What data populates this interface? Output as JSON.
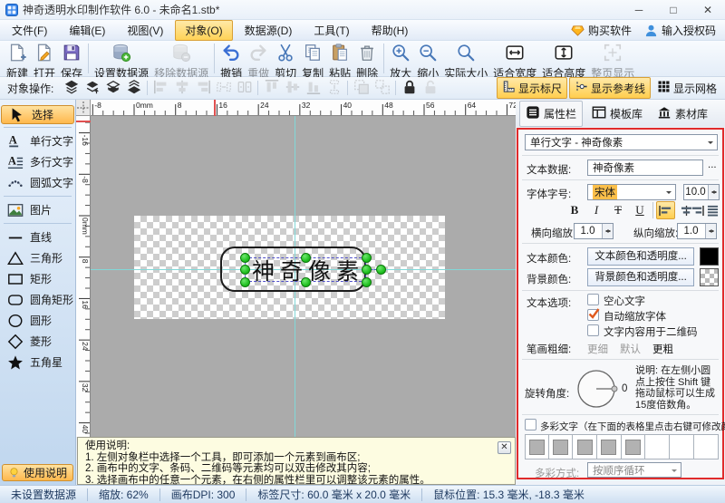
{
  "window": {
    "title": "神奇透明水印制作软件 6.0 - 未命名1.stb*",
    "minimize": "─",
    "maximize": "□",
    "close": "✕"
  },
  "menu": {
    "items": [
      {
        "name": "file",
        "label": "文件(F)"
      },
      {
        "name": "edit",
        "label": "编辑(E)"
      },
      {
        "name": "view",
        "label": "视图(V)"
      },
      {
        "name": "object",
        "label": "对象(O)",
        "cls": "active"
      },
      {
        "name": "datasource",
        "label": "数据源(D)"
      },
      {
        "name": "tools",
        "label": "工具(T)"
      },
      {
        "name": "help",
        "label": "帮助(H)"
      }
    ],
    "buy_label": "购买软件",
    "license_label": "输入授权码"
  },
  "toolbar": {
    "items": [
      {
        "name": "new",
        "label": "新建",
        "icon": "doc-new"
      },
      {
        "name": "open",
        "label": "打开",
        "icon": "doc-open"
      },
      {
        "name": "save",
        "label": "保存",
        "icon": "save"
      },
      {
        "type": "sep"
      },
      {
        "name": "set-datasource",
        "label": "设置数据源",
        "icon": "db-set"
      },
      {
        "name": "remove-datasource",
        "label": "移除数据源",
        "icon": "db-remove",
        "cls": "disabled"
      },
      {
        "type": "sep"
      },
      {
        "name": "undo",
        "label": "撤销",
        "icon": "undo"
      },
      {
        "name": "redo",
        "label": "重做",
        "icon": "redo",
        "cls": "disabled"
      },
      {
        "name": "cut",
        "label": "剪切",
        "icon": "cut"
      },
      {
        "name": "copy",
        "label": "复制",
        "icon": "copy"
      },
      {
        "name": "paste",
        "label": "粘贴",
        "icon": "paste"
      },
      {
        "name": "delete",
        "label": "删除",
        "icon": "delete"
      },
      {
        "type": "sep"
      },
      {
        "name": "zoom-in",
        "label": "放大",
        "icon": "zoom-in"
      },
      {
        "name": "zoom-out",
        "label": "缩小",
        "icon": "zoom-out"
      },
      {
        "name": "actual-size",
        "label": "实际大小",
        "icon": "zoom-actual"
      },
      {
        "name": "fit-width",
        "label": "适合宽度",
        "icon": "fit-width"
      },
      {
        "name": "fit-height",
        "label": "适合高度",
        "icon": "fit-height"
      },
      {
        "name": "fit-page",
        "label": "整页显示",
        "icon": "fit-page",
        "cls": "disabled"
      }
    ]
  },
  "objectbar": {
    "label": "对象操作:",
    "items": [
      {
        "name": "layer-top",
        "icon": "layer-top"
      },
      {
        "name": "layer-up",
        "icon": "layer-up"
      },
      {
        "name": "layer-down",
        "icon": "layer-down"
      },
      {
        "name": "layer-bottom",
        "icon": "layer-bottom"
      },
      {
        "type": "sep"
      },
      {
        "name": "align-left",
        "icon": "oalign-left",
        "cls": "disabled"
      },
      {
        "name": "align-center",
        "icon": "oalign-center",
        "cls": "disabled"
      },
      {
        "name": "align-right",
        "icon": "oalign-right",
        "cls": "disabled"
      },
      {
        "name": "space-horizontal",
        "icon": "space-h",
        "cls": "disabled"
      },
      {
        "name": "same-width",
        "icon": "same-w",
        "cls": "disabled"
      },
      {
        "type": "sep"
      },
      {
        "name": "align-top",
        "icon": "oalign-top",
        "cls": "disabled"
      },
      {
        "name": "align-middle",
        "icon": "oalign-middle",
        "cls": "disabled"
      },
      {
        "name": "align-bottom",
        "icon": "oalign-bottom",
        "cls": "disabled"
      },
      {
        "name": "space-vertical",
        "icon": "space-v",
        "cls": "disabled"
      },
      {
        "type": "sep"
      },
      {
        "name": "group",
        "icon": "group",
        "cls": "disabled"
      },
      {
        "name": "ungroup",
        "icon": "ungroup",
        "cls": "disabled"
      },
      {
        "type": "sep"
      },
      {
        "name": "lock",
        "icon": "lock"
      },
      {
        "name": "unlock",
        "icon": "unlock",
        "cls": "disabled"
      }
    ],
    "toggles": [
      {
        "name": "show-ruler",
        "label": "显示标尺",
        "icon": "ruler",
        "cls": "active"
      },
      {
        "name": "show-guides",
        "label": "显示参考线",
        "icon": "guides",
        "cls": "active"
      },
      {
        "name": "show-grid",
        "label": "显示网格",
        "icon": "grid"
      }
    ]
  },
  "sidebar": {
    "tools": [
      {
        "name": "select",
        "label": "选择",
        "icon": "select",
        "cls": "active"
      },
      {
        "type": "sep"
      },
      {
        "name": "single-line-text",
        "label": "单行文字",
        "icon": "single-text"
      },
      {
        "name": "multi-line-text",
        "label": "多行文字",
        "icon": "multi-text"
      },
      {
        "name": "arc-text",
        "label": "圆弧文字",
        "icon": "arc-text"
      },
      {
        "type": "sep"
      },
      {
        "name": "image",
        "label": "图片",
        "icon": "image"
      },
      {
        "type": "sep"
      },
      {
        "name": "line",
        "label": "直线",
        "icon": "line"
      },
      {
        "name": "triangle",
        "label": "三角形",
        "icon": "triangle"
      },
      {
        "name": "rectangle",
        "label": "矩形",
        "icon": "rectangle"
      },
      {
        "name": "rounded-rectangle",
        "label": "圆角矩形",
        "icon": "rounded-rect"
      },
      {
        "name": "circle",
        "label": "圆形",
        "icon": "circle"
      },
      {
        "name": "diamond",
        "label": "菱形",
        "icon": "diamond"
      },
      {
        "name": "star",
        "label": "五角星",
        "icon": "star"
      }
    ],
    "help_label": "使用说明"
  },
  "rulers": {
    "h_labels": [
      "-8",
      "0mm",
      "8",
      "16",
      "24",
      "32",
      "40",
      "48",
      "56",
      "64",
      "72"
    ],
    "v_labels": [
      "-16",
      "-8",
      "0mm",
      "8",
      "16",
      "24",
      "32",
      "40"
    ]
  },
  "canvas": {
    "design_text": "神奇像素"
  },
  "help_panel": {
    "title": "使用说明:",
    "lines": [
      "1. 左侧对象栏中选择一个工具，即可添加一个元素到画布区;",
      "2. 画布中的文字、条码、二维码等元素均可以双击修改其内容;",
      "3. 选择画布中的任意一个元素，在右侧的属性栏里可以调整该元素的属性。"
    ],
    "close": "✕"
  },
  "panel": {
    "tabs": [
      {
        "name": "properties",
        "label": "属性栏",
        "icon": "tab-props",
        "cls": "active"
      },
      {
        "name": "templates",
        "label": "模板库",
        "icon": "tab-templates"
      },
      {
        "name": "materials",
        "label": "素材库",
        "icon": "tab-materials"
      }
    ],
    "object_selector": "单行文字 - 神奇像素",
    "text_data_label": "文本数据:",
    "text_data_value": "神奇像素",
    "more_button": "...",
    "font_label": "字体字号:",
    "font_family": "宋体",
    "font_size": "10.0",
    "format": {
      "bold": "B",
      "italic": "I",
      "strike": "T",
      "underline": "U"
    },
    "scale_h_label": "横向缩放:",
    "scale_h_value": "1.0",
    "scale_v_label": "纵向缩放:",
    "scale_v_value": "1.0",
    "text_color_label": "文本颜色:",
    "text_color_button": "文本颜色和透明度...",
    "text_color_value": "#000000",
    "bg_color_label": "背景颜色:",
    "bg_color_button": "背景颜色和透明度...",
    "text_options_label": "文本选项:",
    "options": [
      {
        "name": "hollow-text",
        "label": "空心文字",
        "checked": false
      },
      {
        "name": "auto-scale-font",
        "label": "自动缩放字体",
        "checked": true
      },
      {
        "name": "text-as-qrcode",
        "label": "文字内容用于二维码",
        "checked": false
      }
    ],
    "stroke_label": "笔画粗细:",
    "stroke_options": [
      {
        "name": "thinner",
        "label": "更细",
        "cls": "dim"
      },
      {
        "name": "default",
        "label": "默认",
        "cls": "dim"
      },
      {
        "name": "thicker",
        "label": "更粗",
        "cls": "strong"
      }
    ],
    "rotation_label": "旋转角度:",
    "rotation_value": "0",
    "rotation_note": "说明: 在左侧小圆点上按住 Shift 键拖动鼠标可以生成15度倍数角。",
    "multicolor_label": "多彩文字（在下面的表格里点击右键可修改颜色）",
    "multicolor_cells": [
      {
        "filled": true
      },
      {
        "filled": true
      },
      {
        "filled": true
      },
      {
        "filled": true
      },
      {
        "filled": true
      },
      {
        "filled": false
      },
      {
        "filled": false
      },
      {
        "filled": false
      }
    ],
    "mc_mode_label": "多彩方式:",
    "mc_mode_value": "按顺序循环"
  },
  "statusbar": {
    "items": [
      "未设置数据源",
      "缩放: 62%",
      "画布DPI: 300",
      "标签尺寸: 60.0 毫米 x 20.0 毫米",
      "鼠标位置: 15.3 毫米, -18.3 毫米"
    ]
  },
  "colors": {
    "accent_orange": "#ffce4f",
    "panel_border_red": "#e02b2b",
    "guide_cyan": "#82d8d8",
    "handle_green": "#22c122",
    "canvas_gray": "#ababab"
  }
}
